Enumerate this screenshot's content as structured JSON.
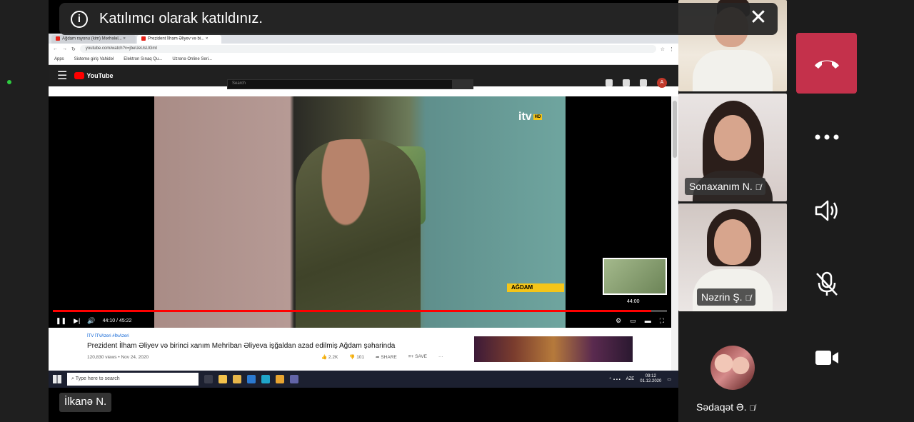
{
  "banner": {
    "text": "Katılımcı olarak katıldınız."
  },
  "presenter": {
    "name": "İlkanə N."
  },
  "participants": [
    {
      "name": "Sonaxanım N."
    },
    {
      "name": "Nəzrin Ş."
    },
    {
      "name": "Sədaqət Ə."
    }
  ],
  "controls": {
    "end_call": "phone-hangup-icon",
    "more": "more-options-icon",
    "speaker": "speaker-icon",
    "mic": "mic-muted-icon",
    "camera": "camera-icon"
  },
  "browser": {
    "tabs": [
      "Ağdam rayonu (kim) Mərhələl... ×",
      "Prezident İlham Əliyev və bi... ×"
    ],
    "url": "youtube.com/watch?v=jbeUeUsUGmI",
    "bookmarks": [
      "Apps",
      "Sistemə giriş Vahidəl",
      "Elektron Sınaq Qu...",
      "Uzrənə Online Seri..."
    ]
  },
  "youtube": {
    "search_placeholder": "Search",
    "account_initial": "A",
    "channel": "İTV İTVAzeri #İtvAzeri",
    "video_title": "Prezident İlham Əliyev və birinci xanım Mehriban Əliyeva işğaldan azad edilmiş Ağdam şəharinda",
    "views": "120,830 views • Nov 24, 2020",
    "likes": "2.2K",
    "dislikes": "101",
    "share": "SHARE",
    "save": "SAVE",
    "time": "44:10 / 45:22",
    "preview_time": "44:00",
    "progress_fraction": 0.974,
    "overlay_logo": "itv",
    "overlay_logo_badge": "HD",
    "location_tag": "AĞDAM"
  },
  "taskbar": {
    "search_placeholder": "Type here to search",
    "lang": "AZE",
    "time": "09:12",
    "date": "01.12.2020"
  }
}
